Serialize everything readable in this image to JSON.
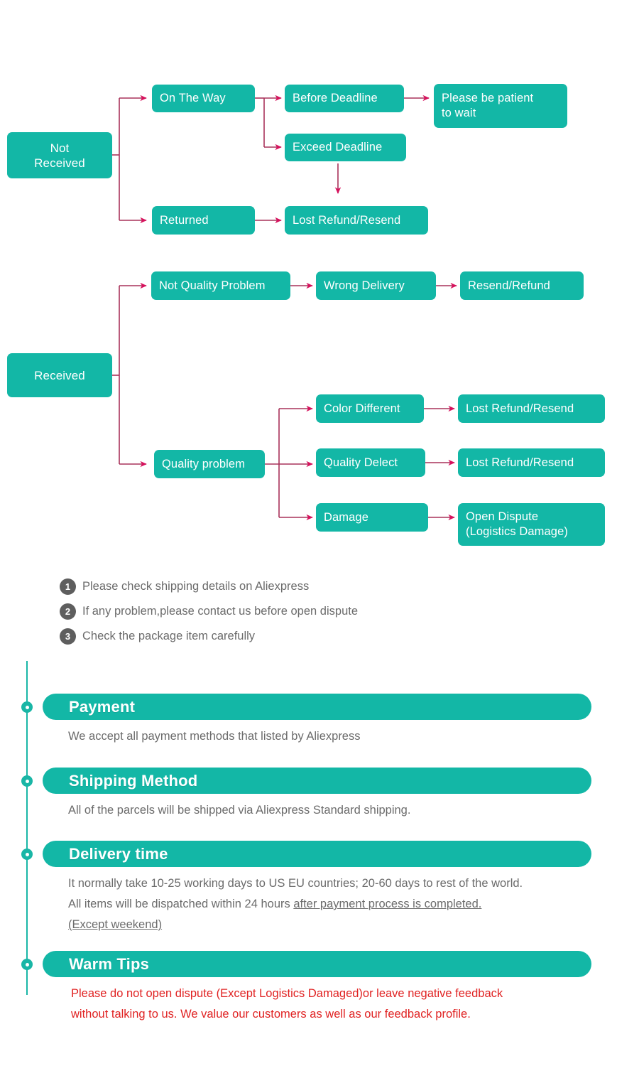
{
  "theme": {
    "node_fill": "#13b7a6",
    "arrow_head": "#d6115c",
    "arrow_line": "#a8325a",
    "note_circle": "#5e5e5e",
    "note_text": "#6b6b6b",
    "timeline": "#19b6a6",
    "warn_text": "#e02222"
  },
  "flowchart": {
    "not_received": {
      "root": "Not\nReceived",
      "root_line1": "Not",
      "root_line2": "Received",
      "on_the_way": "On The Way",
      "before_deadline": "Before Deadline",
      "please_be_patient": "Please be patient\nto wait",
      "please_be_patient_line1": "Please be patient",
      "please_be_patient_line2": "to wait",
      "exceed_deadline": "Exceed Deadline",
      "returned": "Returned",
      "lost_refund_resend": "Lost Refund/Resend"
    },
    "received": {
      "root": "Received",
      "not_quality_problem": "Not Quality Problem",
      "wrong_delivery": "Wrong Delivery",
      "resend_refund": "Resend/Refund",
      "quality_problem": "Quality problem",
      "color_different": "Color Different",
      "lost_refund_resend_1": "Lost Refund/Resend",
      "quality_delect": "Quality Delect",
      "lost_refund_resend_2": "Lost Refund/Resend",
      "damage": "Damage",
      "open_dispute_line1": "Open Dispute",
      "open_dispute_line2": "(Logistics Damage)"
    }
  },
  "notes": [
    {
      "num": "1",
      "text": "Please check shipping details on Aliexpress"
    },
    {
      "num": "2",
      "text": "If any problem,please contact us before open dispute"
    },
    {
      "num": "3",
      "text": "Check the package item carefully"
    }
  ],
  "panels": {
    "payment": {
      "title": "Payment",
      "body": "We accept all payment methods that listed by Aliexpress"
    },
    "shipping": {
      "title": "Shipping Method",
      "body": "All of the parcels will be shipped via Aliexpress Standard shipping."
    },
    "delivery": {
      "title": "Delivery time",
      "line1": "It normally take 10-25 working days to US EU countries; 20-60 days to rest of the world.",
      "line2_plain": "All items will be dispatched within 24 hours ",
      "line2_underline": "after payment process is completed.",
      "line3_underline": "(Except weekend)"
    },
    "warm": {
      "title": "Warm Tips",
      "line1": "Please do not open dispute (Except Logistics Damaged)or leave negative feedback",
      "line2": "without talking to us. We value our customers as well as our feedback profile."
    }
  }
}
